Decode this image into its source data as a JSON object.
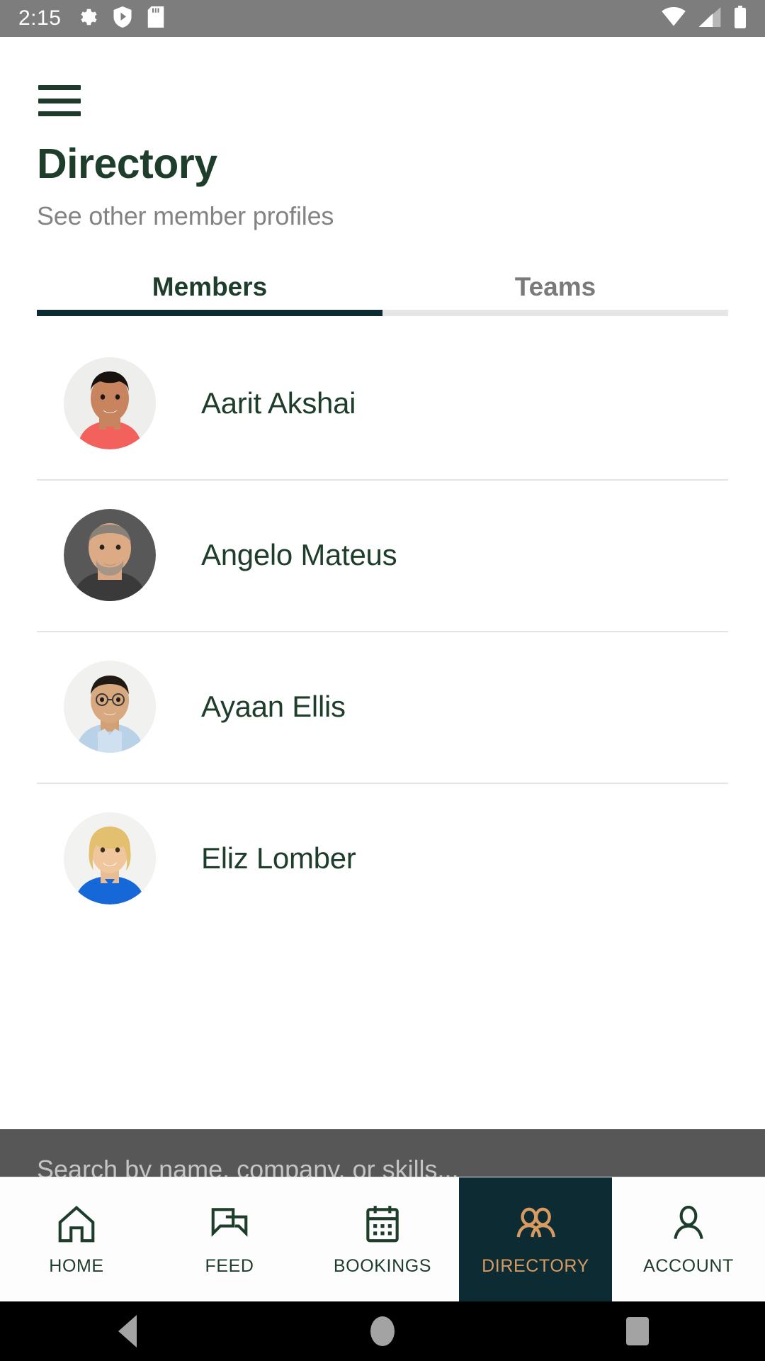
{
  "status_bar": {
    "time": "2:15",
    "left_icons": [
      "gear-icon",
      "shield-play-icon",
      "sd-card-icon"
    ],
    "right_icons": [
      "wifi-icon",
      "cellular-signal-icon",
      "battery-icon"
    ]
  },
  "header": {
    "menu_icon": "hamburger-menu-icon",
    "title": "Directory",
    "subtitle": "See other member profiles"
  },
  "tabs": [
    {
      "label": "Members",
      "active": true
    },
    {
      "label": "Teams",
      "active": false
    }
  ],
  "members": [
    {
      "name": "Aarit Akshai"
    },
    {
      "name": "Angelo Mateus"
    },
    {
      "name": "Ayaan Ellis"
    },
    {
      "name": "Eliz Lomber"
    }
  ],
  "search": {
    "placeholder": "Search by name, company, or skills...",
    "value": ""
  },
  "bottom_nav": [
    {
      "label": "HOME",
      "icon": "home-icon",
      "active": false
    },
    {
      "label": "FEED",
      "icon": "chat-bubbles-icon",
      "active": false
    },
    {
      "label": "BOOKINGS",
      "icon": "calendar-icon",
      "active": false
    },
    {
      "label": "DIRECTORY",
      "icon": "people-icon",
      "active": true
    },
    {
      "label": "ACCOUNT",
      "icon": "person-icon",
      "active": false
    }
  ],
  "android_nav": [
    {
      "label": "back-button"
    },
    {
      "label": "home-button"
    },
    {
      "label": "recents-button"
    }
  ],
  "colors": {
    "brand_green": "#1e3d2a",
    "tab_indicator": "#0c2b33",
    "active_nav_bg": "#0c2b33",
    "active_nav_fg": "#d99a62",
    "status_bar_bg": "#7d7d7d",
    "muted_text": "#838383"
  }
}
